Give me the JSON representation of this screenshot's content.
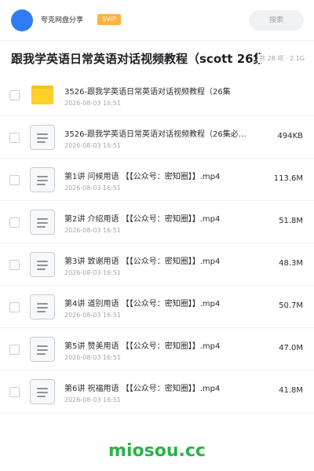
{
  "header": {
    "app_title": "夸克网盘分享",
    "badge": "SVIP",
    "search_placeholder": "搜索"
  },
  "folder": {
    "title": "跟我学英语日常英语对话视频教程（scott 26集）",
    "meta": "共 28 项 · 2.1G"
  },
  "files": [
    {
      "type": "folder",
      "name": "3526-跟我学英语日常英语对话视频教程（26集",
      "date": "2026-08-03 16:51",
      "size": ""
    },
    {
      "type": "file",
      "name": "3526-跟我学英语日常英语对话视频教程（26集必…",
      "date": "2026-08-03 16:51",
      "size": "494KB"
    },
    {
      "type": "file",
      "name": "第1讲 问候用语 【【公众号：密知圈】】.mp4",
      "date": "2026-08-03 16:51",
      "size": "113.6M"
    },
    {
      "type": "file",
      "name": "第2讲  介绍用语 【【公众号：密知圈】】.mp4",
      "date": "2026-08-03 16:51",
      "size": "51.8M"
    },
    {
      "type": "file",
      "name": "第3讲 致谢用语 【【公众号：密知圈】】.mp4",
      "date": "2026-08-03 16:51",
      "size": "48.3M"
    },
    {
      "type": "file",
      "name": "第4讲  道别用语 【【公众号：密知圈】】.mp4",
      "date": "2026-08-03 16:51",
      "size": "50.7M"
    },
    {
      "type": "file",
      "name": "第5讲 赞美用语 【【公众号：密知圈】】.mp4",
      "date": "2026-08-03 16:51",
      "size": "47.0M"
    },
    {
      "type": "file",
      "name": "第6讲 祝福用语 【【公众号：密知圈】】.mp4",
      "date": "2026-08-03 16:51",
      "size": "41.8M"
    }
  ],
  "watermark": "miosou.cc",
  "colors": {
    "brand": "#2f7cf6",
    "svip": "#ffb23e",
    "folder": "#ffcf2a",
    "watermark": "#2cb34a"
  },
  "icons": {
    "logo": "quark-logo-icon",
    "folder": "folder-icon",
    "file": "document-icon"
  }
}
